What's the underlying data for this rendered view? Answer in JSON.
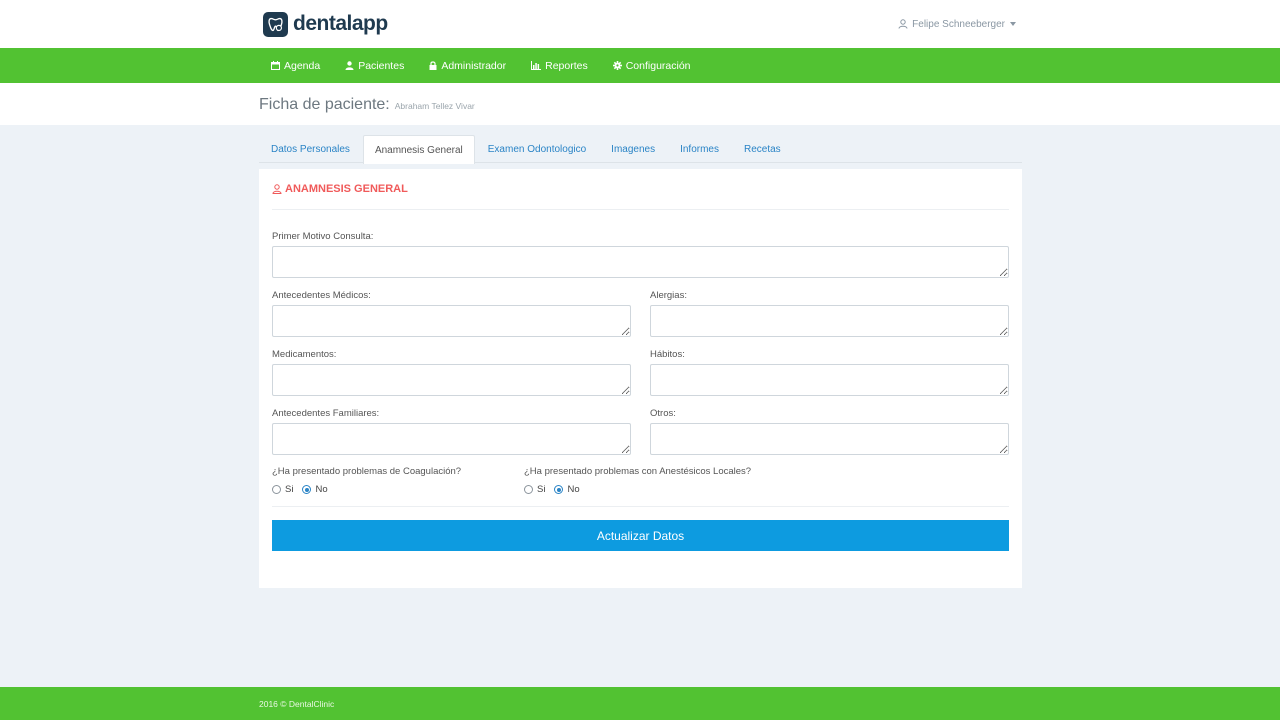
{
  "brand": {
    "name": "dentalapp",
    "colors": {
      "primary": "#1f3a4f",
      "nav": "#52c232",
      "button": "#0d9be0",
      "accent": "#f05a5a",
      "link": "#2a84c6"
    }
  },
  "user": {
    "name": "Felipe Schneeberger",
    "icon": "user-icon"
  },
  "nav": [
    {
      "label": "Agenda",
      "icon": "calendar-icon"
    },
    {
      "label": "Pacientes",
      "icon": "user-icon"
    },
    {
      "label": "Administrador",
      "icon": "lock-icon"
    },
    {
      "label": "Reportes",
      "icon": "bar-chart-icon"
    },
    {
      "label": "Configuración",
      "icon": "gear-icon"
    }
  ],
  "page": {
    "title": "Ficha de paciente:",
    "patient": "Abraham Tellez Vivar"
  },
  "tabs": [
    {
      "label": "Datos Personales",
      "active": false
    },
    {
      "label": "Anamnesis General",
      "active": true
    },
    {
      "label": "Examen Odontologico",
      "active": false
    },
    {
      "label": "Imagenes",
      "active": false
    },
    {
      "label": "Informes",
      "active": false
    },
    {
      "label": "Recetas",
      "active": false
    }
  ],
  "form": {
    "section_title": "ANAMNESIS GENERAL",
    "primer_motivo": {
      "label": "Primer Motivo Consulta:",
      "value": ""
    },
    "antecedentes_medicos": {
      "label": "Antecedentes Médicos:",
      "value": ""
    },
    "alergias": {
      "label": "Alergias:",
      "value": ""
    },
    "medicamentos": {
      "label": "Medicamentos:",
      "value": ""
    },
    "habitos": {
      "label": "Hábitos:",
      "value": ""
    },
    "antecedentes_familiares": {
      "label": "Antecedentes Familiares:",
      "value": ""
    },
    "otros": {
      "label": "Otros:",
      "value": ""
    },
    "coagulacion": {
      "label": "¿Ha presentado problemas de Coagulación?",
      "options": [
        "Si",
        "No"
      ],
      "selected": "No"
    },
    "anestesicos": {
      "label": "¿Ha presentado problemas con Anestésicos Locales?",
      "options": [
        "Si",
        "No"
      ],
      "selected": "No"
    },
    "submit_label": "Actualizar Datos"
  },
  "footer": {
    "text": "2016 © DentalClinic"
  }
}
